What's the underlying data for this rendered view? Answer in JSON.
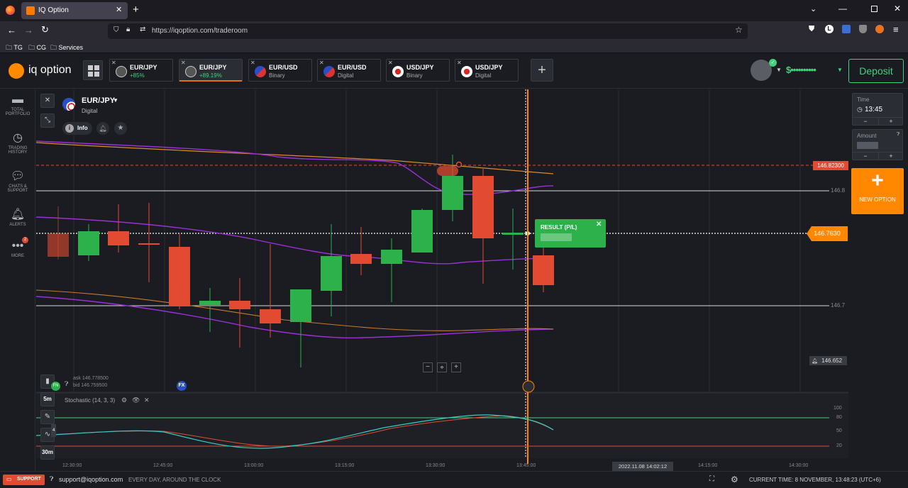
{
  "browser": {
    "tab_title": "IQ Option",
    "url": "https://iqoption.com/traderoom",
    "url_host": "iqoption.com",
    "url_path": "/traderoom",
    "bookmarks": [
      "TG",
      "CG",
      "Services"
    ]
  },
  "header": {
    "logo_text": "iq option",
    "balance_masked": "$••••••••••",
    "deposit_label": "Deposit",
    "add_tab": "+",
    "asset_tabs": [
      {
        "name": "EUR/JPY",
        "sub": "+85%",
        "sub_green": true,
        "active": false
      },
      {
        "name": "EUR/JPY",
        "sub": "+89.19%",
        "sub_green": true,
        "active": true
      },
      {
        "name": "EUR/USD",
        "sub": "Binary",
        "sub_green": false,
        "active": false
      },
      {
        "name": "EUR/USD",
        "sub": "Digital",
        "sub_green": false,
        "active": false
      },
      {
        "name": "USD/JPY",
        "sub": "Binary",
        "sub_green": false,
        "active": false
      },
      {
        "name": "USD/JPY",
        "sub": "Digital",
        "sub_green": false,
        "active": false
      }
    ]
  },
  "sidebar": {
    "items": [
      {
        "label": "TOTAL PORTFOLIO",
        "icon": "briefcase-icon"
      },
      {
        "label": "TRADING HISTORY",
        "icon": "history-icon"
      },
      {
        "label": "CHATS & SUPPORT",
        "icon": "chat-icon"
      },
      {
        "label": "ALERTS",
        "icon": "bell-icon"
      },
      {
        "label": "MORE",
        "icon": "more-icon",
        "badge": "2"
      }
    ]
  },
  "asset": {
    "name": "EUR/JPY",
    "type": "Digital",
    "info_label": "Info"
  },
  "chart": {
    "price_labels": {
      "strike": "146.82300",
      "level_1": "146.8",
      "current": "146.7630",
      "level_2": "146.7",
      "low": "146.652"
    },
    "ask": "ask 146.778500",
    "bid": "bid 146.759500",
    "result_label": "RESULT (P/L)",
    "time_ticks": [
      "12:30:00",
      "12:45:00",
      "13:00:00",
      "13:15:00",
      "13:30:00",
      "13:45:00",
      "14:15:00",
      "14:30:00"
    ],
    "crosshair_time": "2022.11.08 14:02:12",
    "indicator_label": "Stochastic (14, 3, 3)",
    "stoch_ticks": [
      "100",
      "80",
      "50",
      "20"
    ],
    "timeframes": [
      "5m",
      "30m"
    ],
    "tool_badge": "4"
  },
  "right_panel": {
    "time_label": "Time",
    "time_value": "13:45",
    "amount_label": "Amount",
    "new_option": "NEW OPTION",
    "minus": "−",
    "plus": "+"
  },
  "footer": {
    "support": "SUPPORT",
    "email": "support@iqoption.com",
    "hours": "EVERY DAY, AROUND THE CLOCK",
    "current_time": "CURRENT TIME: 8 NOVEMBER, 13:48:23 (UTC+6)"
  },
  "colors": {
    "accent": "#ff8800",
    "bull": "#2db14b",
    "bear": "#e24b31",
    "deposit": "#43d17a"
  }
}
